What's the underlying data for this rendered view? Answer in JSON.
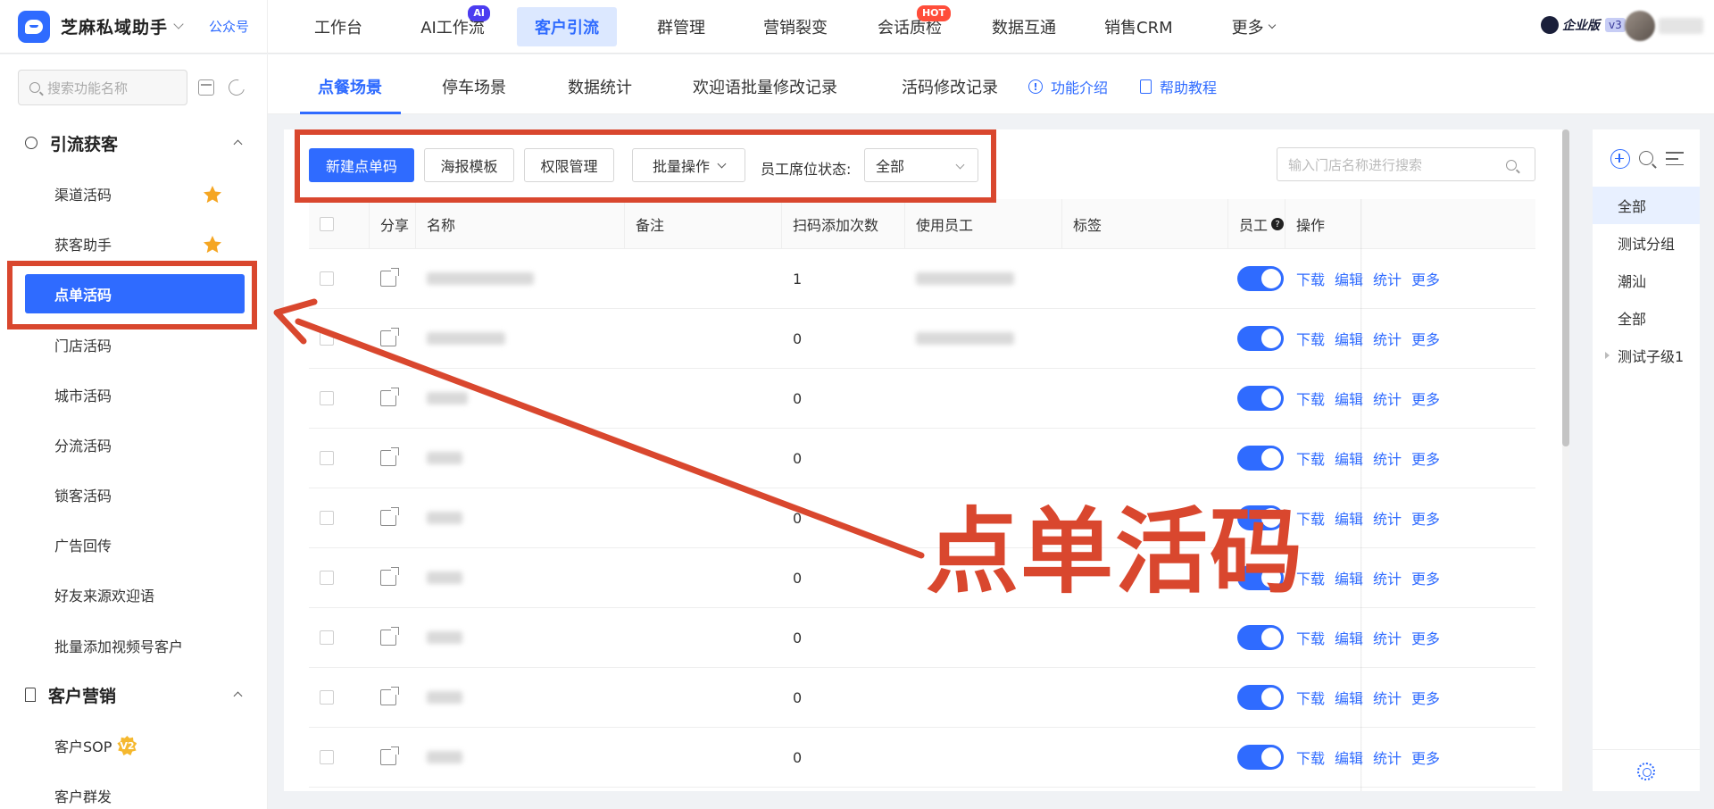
{
  "app": {
    "name": "芝麻私域助手",
    "public_account_link": "公众号",
    "edition_label": "企业版",
    "edition_version": "v3"
  },
  "top_nav": [
    {
      "label": "工作台",
      "badge": ""
    },
    {
      "label": "AI工作流",
      "badge": "AI"
    },
    {
      "label": "客户引流",
      "badge": "",
      "active": true
    },
    {
      "label": "群管理",
      "badge": ""
    },
    {
      "label": "营销裂变",
      "badge": ""
    },
    {
      "label": "会话质检",
      "badge": "HOT"
    },
    {
      "label": "数据互通",
      "badge": ""
    },
    {
      "label": "销售CRM",
      "badge": ""
    },
    {
      "label": "更多",
      "badge": ""
    }
  ],
  "sidebar": {
    "search_placeholder": "搜索功能名称",
    "groups": [
      {
        "label": "引流获客",
        "items": [
          {
            "label": "渠道活码",
            "starred": true
          },
          {
            "label": "获客助手",
            "starred": true
          },
          {
            "label": "点单活码",
            "active": true
          },
          {
            "label": "门店活码"
          },
          {
            "label": "城市活码"
          },
          {
            "label": "分流活码"
          },
          {
            "label": "锁客活码"
          },
          {
            "label": "广告回传"
          },
          {
            "label": "好友来源欢迎语"
          },
          {
            "label": "批量添加视频号客户"
          }
        ]
      },
      {
        "label": "客户营销",
        "items": [
          {
            "label": "客户SOP",
            "badge": "V2"
          },
          {
            "label": "客户群发"
          }
        ]
      }
    ]
  },
  "sub_tabs": [
    {
      "label": "点餐场景",
      "active": true
    },
    {
      "label": "停车场景"
    },
    {
      "label": "数据统计"
    },
    {
      "label": "欢迎语批量修改记录"
    },
    {
      "label": "活码修改记录"
    }
  ],
  "sub_links": {
    "intro": "功能介绍",
    "tutorial": "帮助教程"
  },
  "toolbar": {
    "new_button": "新建点单码",
    "poster_button": "海报模板",
    "permission_button": "权限管理",
    "batch_button": "批量操作",
    "status_label": "员工席位状态:",
    "status_value": "全部",
    "store_search_placeholder": "输入门店名称进行搜索"
  },
  "table": {
    "columns": [
      "分享",
      "名称",
      "备注",
      "扫码添加次数",
      "使用员工",
      "标签",
      "员工",
      "操作"
    ],
    "actions": [
      "下载",
      "编辑",
      "统计",
      "更多"
    ],
    "rows": [
      {
        "scan_count": "1"
      },
      {
        "scan_count": "0"
      },
      {
        "scan_count": "0"
      },
      {
        "scan_count": "0"
      },
      {
        "scan_count": "0"
      },
      {
        "scan_count": "0"
      },
      {
        "scan_count": "0"
      },
      {
        "scan_count": "0"
      },
      {
        "scan_count": "0"
      }
    ]
  },
  "group_tree": [
    {
      "label": "全部",
      "active": true
    },
    {
      "label": "测试分组"
    },
    {
      "label": "潮汕"
    },
    {
      "label": "全部"
    },
    {
      "label": "测试子级1",
      "expandable": true
    }
  ],
  "annotation": {
    "callout_text": "点单活码",
    "color": "#d9472e"
  },
  "colors": {
    "accent": "#2f6bff",
    "hot_badge": "#ff4d3a",
    "ai_badge": "#4b3cf0",
    "star": "#f5a623"
  }
}
